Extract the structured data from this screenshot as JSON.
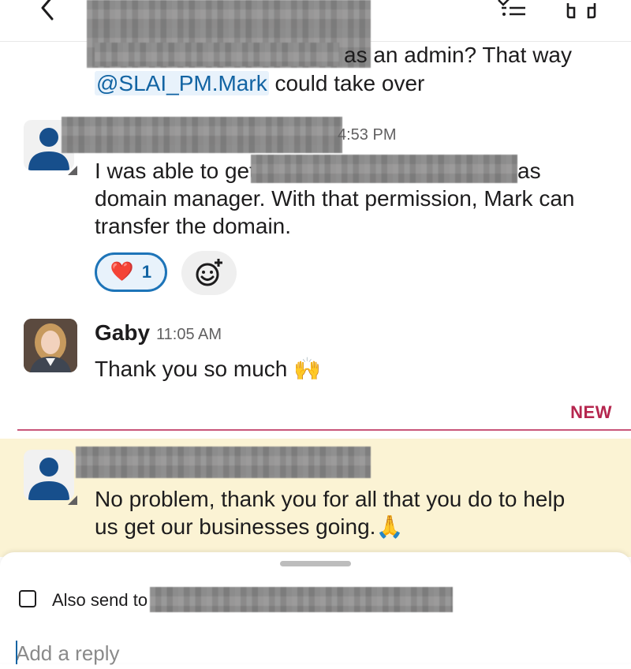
{
  "header": {
    "back_icon": "chevron-left-icon",
    "filter_icon": "filter-icon",
    "huddle_icon": "headphones-icon"
  },
  "messages": [
    {
      "text_line1": "as an admin? That way",
      "mention": "@SLAI_PM.Mark",
      "text_line2_rest": " could take over"
    },
    {
      "time": "4:53 PM",
      "line1_start": "I was able to get",
      "line1_end": "as",
      "line2": "domain manager. With that permission, Mark can",
      "line3": "transfer the domain.",
      "reaction": {
        "emoji": "❤️",
        "count": "1"
      },
      "add_reaction_icon": "add-reaction-icon"
    },
    {
      "name": "Gaby",
      "time": "11:05 AM",
      "text": "Thank you so much 🙌"
    },
    {
      "line1": "No problem, thank you for all that you do to help",
      "line2": "us get our businesses going.🙏"
    }
  ],
  "divider": {
    "label": "NEW"
  },
  "composer": {
    "also_send_label": "Also send to",
    "reply_placeholder": "Add a reply"
  },
  "colors": {
    "mention": "#1264a3",
    "new_divider": "#b5264e",
    "highlight": "#fbf3d4",
    "avatar_blue": "#174f8c"
  }
}
